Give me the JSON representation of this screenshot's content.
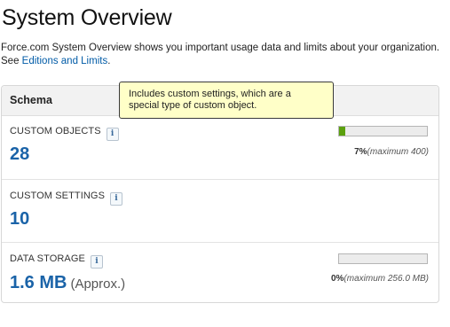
{
  "page": {
    "title": "System Overview",
    "intro_text": "Force.com System Overview shows you important usage data and limits about your organization.",
    "intro_see": "See",
    "intro_link": "Editions and Limits",
    "intro_period": "."
  },
  "tooltip": {
    "text": "Includes custom settings, which are a special type of custom object."
  },
  "schema": {
    "header": "Schema",
    "items": [
      {
        "label": "CUSTOM OBJECTS",
        "value": "28",
        "percent_text": "7%",
        "maximum_text": "(maximum 400)",
        "usage_fraction": 0.07
      },
      {
        "label": "CUSTOM SETTINGS",
        "value": "10"
      },
      {
        "label": "DATA STORAGE",
        "value": "1.6 MB",
        "value_suffix": "(Approx.)",
        "percent_text": "0%",
        "maximum_text": "(maximum 256.0 MB)",
        "usage_fraction": 0.0
      }
    ]
  },
  "icons": {
    "info": "info-icon"
  },
  "info_glyph": "i",
  "colors": {
    "value_blue": "#1a63a8",
    "bar_green": "#5ba00e",
    "link_blue": "#015ba7",
    "tooltip_bg": "#ffffc8"
  }
}
